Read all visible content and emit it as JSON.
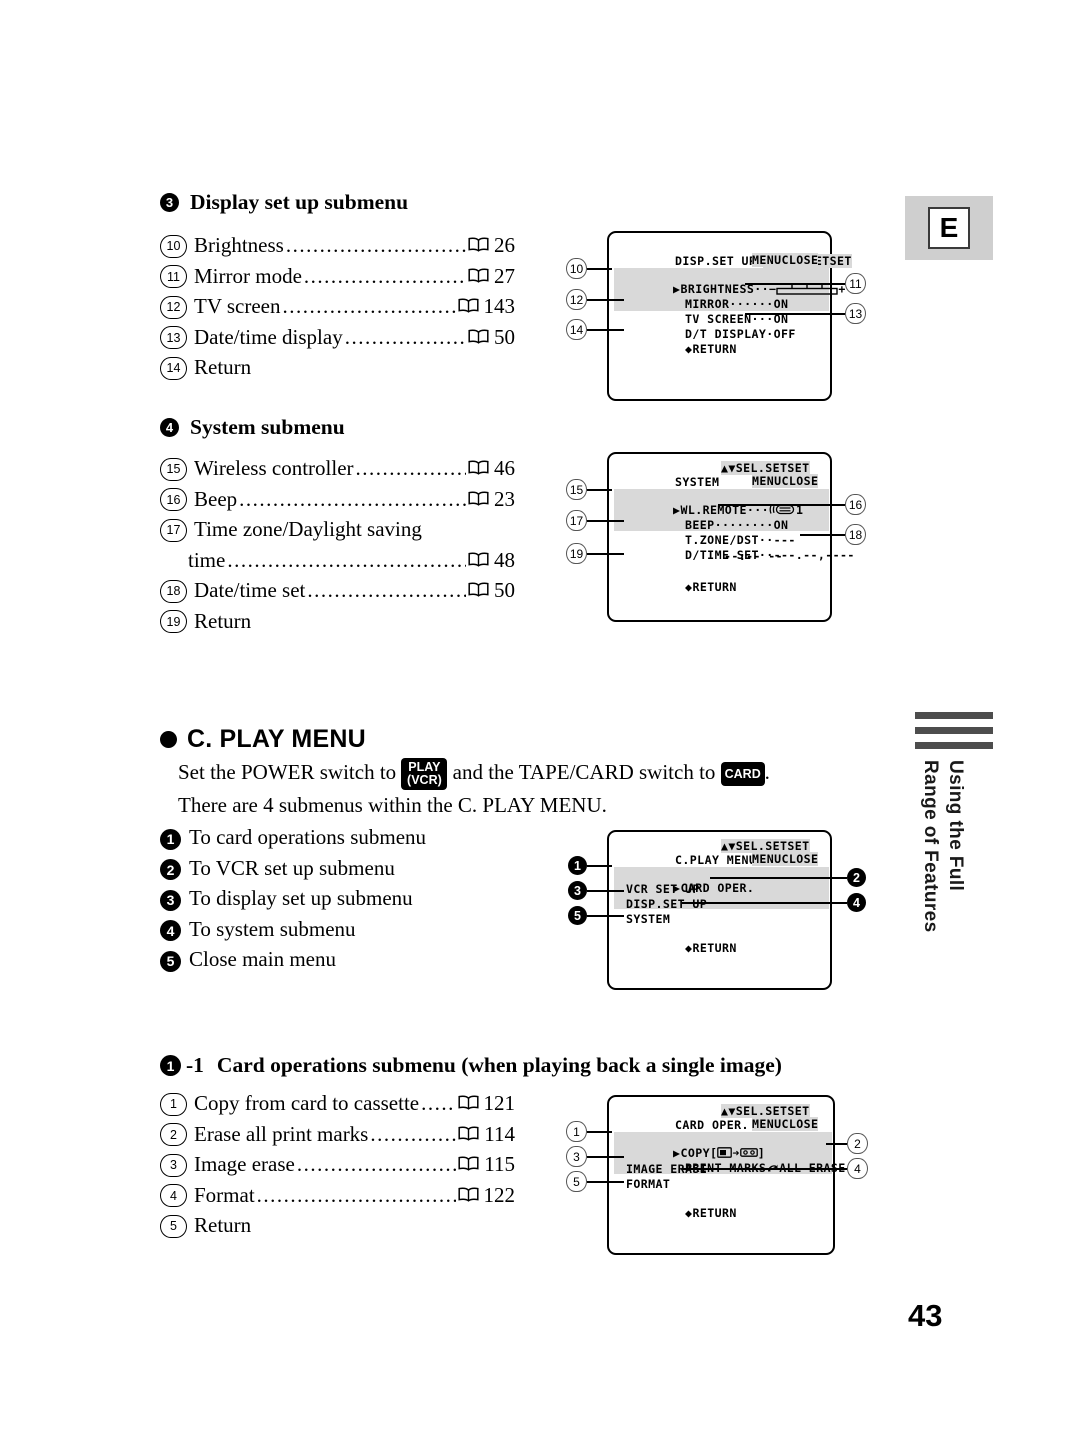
{
  "page": {
    "number": "43",
    "edition_tab": "E",
    "side_tab_text": "Using the Full\nRange of Features"
  },
  "section_display": {
    "marker": "3",
    "title": "Display set up submenu",
    "items": [
      {
        "num": "10",
        "label": "Brightness",
        "page": "26"
      },
      {
        "num": "11",
        "label": "Mirror mode",
        "page": "27"
      },
      {
        "num": "12",
        "label": "TV screen",
        "page": "143"
      },
      {
        "num": "13",
        "label": "Date/time display",
        "page": "50"
      },
      {
        "num": "14",
        "label": "Return",
        "page": ""
      }
    ],
    "lcd": {
      "title": "DISP.SET UP",
      "hint1": "SEL.SETSET",
      "hint2": "MENUCLOSE",
      "rows": [
        {
          "text": "BRIGHTNESS",
          "value": "",
          "selected": true,
          "callout": "10",
          "side": "left"
        },
        {
          "text": "MIRROR",
          "dots": "······",
          "value": "ON",
          "callout": "11",
          "side": "right"
        },
        {
          "text": "TV SCREEN",
          "dots": "···",
          "value": "ON",
          "callout": "12",
          "side": "left"
        },
        {
          "text": "D/T DISPLAY",
          "dots": "·",
          "value": "OFF",
          "callout": "13",
          "side": "right"
        },
        {
          "text": "RETURN",
          "value": "",
          "callout": "14",
          "side": "left"
        }
      ]
    }
  },
  "section_system": {
    "marker": "4",
    "title": "System submenu",
    "items": [
      {
        "num": "15",
        "label": "Wireless controller",
        "page": "46"
      },
      {
        "num": "16",
        "label": "Beep",
        "page": "23"
      },
      {
        "num": "17",
        "label": "Time zone/Daylight saving",
        "label2": "time",
        "page": "48"
      },
      {
        "num": "18",
        "label": "Date/time set",
        "page": "50"
      },
      {
        "num": "19",
        "label": "Return",
        "page": ""
      }
    ],
    "lcd": {
      "title": "SYSTEM",
      "hint1": "SEL.SETSET",
      "hint2": "MENUCLOSE",
      "rows": [
        {
          "text": "WL.REMOTE",
          "dots": "···",
          "value": "1",
          "selected": true,
          "callout": "15",
          "side": "left"
        },
        {
          "text": "BEEP",
          "dots": "········",
          "value": "ON",
          "callout": "16",
          "side": "right"
        },
        {
          "text": "T.ZONE/DST",
          "dots": "··",
          "value": "---",
          "callout": "17",
          "side": "left"
        },
        {
          "text": "D/TIME SET",
          "dots": "··",
          "value": "---.--,----",
          "callout": "18",
          "side": "right"
        },
        {
          "text": "",
          "value": "--:-- --"
        },
        {
          "text": "RETURN",
          "value": "",
          "callout": "19",
          "side": "left"
        }
      ]
    }
  },
  "cplay": {
    "heading": "C. PLAY MENU",
    "intro_a": "Set the POWER switch to",
    "key_play_line1": "PLAY",
    "key_play_line2": "(VCR)",
    "intro_b": "and the TAPE/CARD switch to",
    "key_card": "CARD",
    "intro_c": ".",
    "intro_d": "There are 4 submenus within the C. PLAY MENU.",
    "items": [
      {
        "num": "1",
        "label": "To card operations submenu"
      },
      {
        "num": "2",
        "label": "To VCR set up submenu"
      },
      {
        "num": "3",
        "label": "To display set up submenu"
      },
      {
        "num": "4",
        "label": "To system submenu"
      },
      {
        "num": "5",
        "label": "Close main menu"
      }
    ],
    "lcd": {
      "title": "C.PLAY MENU",
      "hint1": "SEL.SETSET",
      "hint2": "MENUCLOSE",
      "rows": [
        {
          "text": "CARD OPER.",
          "selected": true,
          "callout": "1",
          "side": "left"
        },
        {
          "text": "VCR SET UP",
          "callout": "2",
          "side": "right"
        },
        {
          "text": "DISP.SET UP",
          "callout": "3",
          "side": "left"
        },
        {
          "text": "SYSTEM",
          "callout": "4",
          "side": "right"
        },
        {
          "text": "RETURN",
          "callout": "5",
          "side": "left"
        }
      ]
    }
  },
  "card_ops": {
    "marker": "1",
    "marker_suffix": "-1",
    "title": "Card operations submenu (when playing back a single image)",
    "items": [
      {
        "num": "1",
        "label": "Copy from card to cassette",
        "page": "121"
      },
      {
        "num": "2",
        "label": "Erase all print marks",
        "page": "114"
      },
      {
        "num": "3",
        "label": "Image erase",
        "page": "115"
      },
      {
        "num": "4",
        "label": "Format",
        "page": "122"
      },
      {
        "num": "5",
        "label": "Return",
        "page": ""
      }
    ],
    "lcd": {
      "title": "CARD OPER.",
      "hint1": "SEL.SETSET",
      "hint2": "MENUCLOSE",
      "rows": [
        {
          "text": "COPY[",
          "text_end": "]",
          "selected": true,
          "callout": "1",
          "side": "left"
        },
        {
          "text": "PRINT MARKS",
          "value": "ALL ERASE",
          "callout": "2",
          "side": "right"
        },
        {
          "text": "IMAGE ERASE",
          "callout": "3",
          "side": "left"
        },
        {
          "text": "FORMAT",
          "callout": "4",
          "side": "right"
        },
        {
          "text": "RETURN",
          "callout": "5",
          "side": "left"
        }
      ]
    }
  },
  "icons": {
    "book": "book-icon",
    "arrow_up_down": "▲▼",
    "cursor_arrow": "▶",
    "return_arrow": "←",
    "remote": "remote-icon",
    "card_media": "card-icon",
    "cassette": "cassette-icon",
    "right_arrow": "➜",
    "print_hook": "hook-arrow-icon"
  },
  "colors": {
    "highlight": "#d9d9d9",
    "tab_gray": "#cfcfcf",
    "bar_gray": "#4d4d4d",
    "ink": "#000000"
  }
}
